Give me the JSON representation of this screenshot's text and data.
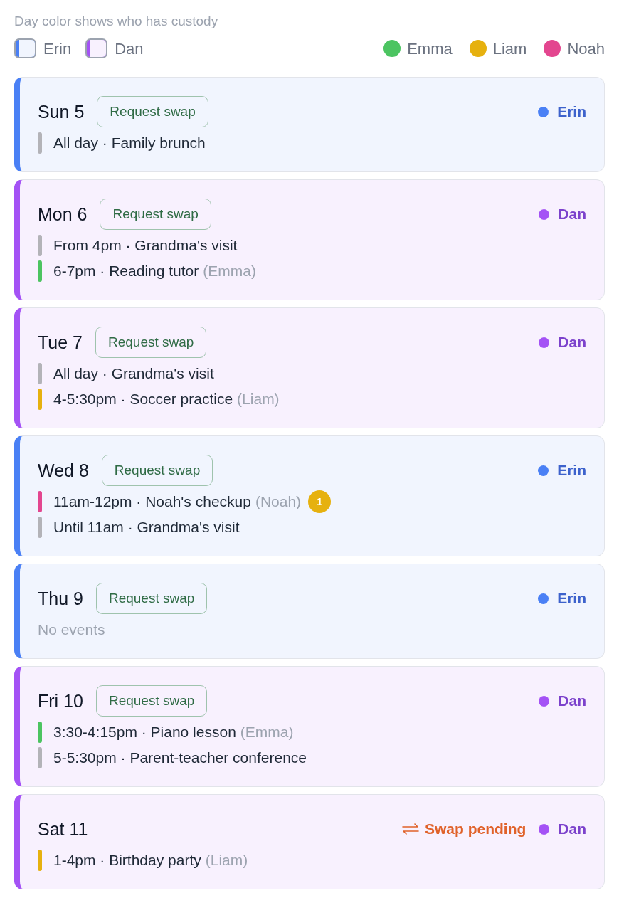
{
  "legend": {
    "caption": "Day color shows who has custody",
    "parents": [
      {
        "name": "Erin",
        "color": "#4a80f5"
      },
      {
        "name": "Dan",
        "color": "#a452f5"
      }
    ],
    "children": [
      {
        "name": "Emma",
        "color": "#4cc461"
      },
      {
        "name": "Liam",
        "color": "#e6b10f"
      },
      {
        "name": "Noah",
        "color": "#e3468f"
      }
    ]
  },
  "days": [
    {
      "label": "Sun 5",
      "swap_button": "Request swap",
      "parent": "Erin",
      "color": "#4a80f5",
      "events": [
        {
          "text": "All day · Family brunch",
          "color": "#b3b3b8"
        }
      ]
    },
    {
      "label": "Mon 6",
      "swap_button": "Request swap",
      "parent": "Dan",
      "color": "#a452f5",
      "events": [
        {
          "text": "From 4pm · Grandma's visit",
          "color": "#b3b3b8"
        },
        {
          "text": "6-7pm · Reading tutor",
          "child": "(Emma)",
          "color": "#4cc461"
        }
      ]
    },
    {
      "label": "Tue 7",
      "swap_button": "Request swap",
      "parent": "Dan",
      "color": "#a452f5",
      "events": [
        {
          "text": "All day · Grandma's visit",
          "color": "#b3b3b8"
        },
        {
          "text": "4-5:30pm · Soccer practice",
          "child": "(Liam)",
          "color": "#e6b10f"
        }
      ]
    },
    {
      "label": "Wed 8",
      "swap_button": "Request swap",
      "parent": "Erin",
      "color": "#4a80f5",
      "events": [
        {
          "text": "11am-12pm · Noah's checkup",
          "child": "(Noah)",
          "color": "#e3468f",
          "badge": "1"
        },
        {
          "text": "Until 11am · Grandma's visit",
          "color": "#b3b3b8"
        }
      ]
    },
    {
      "label": "Thu 9",
      "swap_button": "Request swap",
      "parent": "Erin",
      "color": "#4a80f5",
      "empty_text": "No events"
    },
    {
      "label": "Fri 10",
      "swap_button": "Request swap",
      "parent": "Dan",
      "color": "#a452f5",
      "events": [
        {
          "text": "3:30-4:15pm · Piano lesson",
          "child": "(Emma)",
          "color": "#4cc461"
        },
        {
          "text": "5-5:30pm · Parent-teacher conference",
          "color": "#b3b3b8"
        }
      ]
    },
    {
      "label": "Sat 11",
      "swap_pending": "Swap pending",
      "parent": "Dan",
      "color": "#a452f5",
      "events": [
        {
          "text": "1-4pm · Birthday party",
          "child": "(Liam)",
          "color": "#e6b10f"
        }
      ]
    }
  ]
}
